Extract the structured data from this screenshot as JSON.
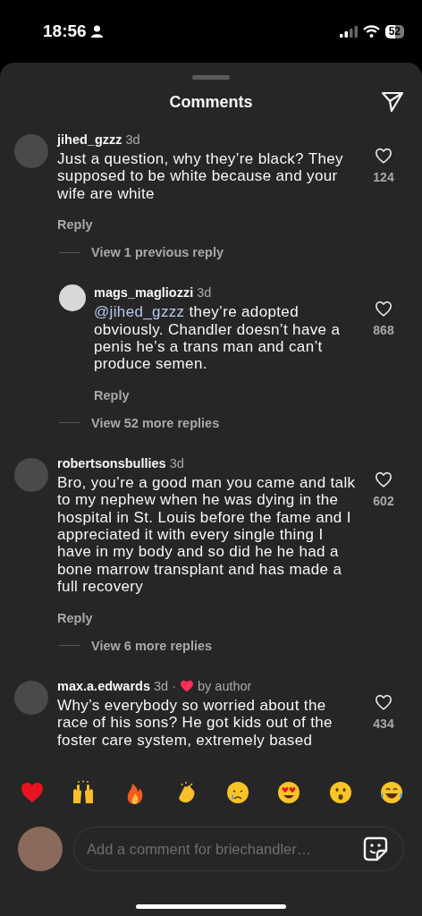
{
  "status_bar": {
    "time": "18:56",
    "battery": "52"
  },
  "header": {
    "title": "Comments"
  },
  "comments": [
    {
      "kind": "comment",
      "username": "jihed_gzzz",
      "time": "3d",
      "text": "Just a question, why they’re black? They supposed to be white because and your wife are white",
      "likes": "124",
      "reply_label": "Reply"
    },
    {
      "kind": "view_more",
      "label": "View 1 previous reply"
    },
    {
      "kind": "reply",
      "username": "mags_magliozzi",
      "time": "3d",
      "mention": "@jihed_gzzz",
      "text": "they’re adopted obviously. Chandler doesn’t have a penis he’s a trans man and can’t produce semen.",
      "likes": "868",
      "reply_label": "Reply"
    },
    {
      "kind": "view_more",
      "label": "View 52 more replies"
    },
    {
      "kind": "comment",
      "username": "robertsonsbullies",
      "time": "3d",
      "text": "Bro, you’re a good man you came and talk to my nephew when he was dying in the hospital in St. Louis before the fame and I appreciated it with every single thing I have in my body and so did he he had a bone marrow transplant and has made a full recovery",
      "likes": "602",
      "reply_label": "Reply"
    },
    {
      "kind": "view_more",
      "label": "View 6 more replies"
    },
    {
      "kind": "comment",
      "username": "max.a.edwards",
      "time": "3d",
      "separator": "·",
      "author_label": "by author",
      "text": "Why’s everybody so worried about the race of his sons? He got kids out of the foster care system, extremely based",
      "likes": "434"
    }
  ],
  "composer": {
    "placeholder": "Add a comment for briechandler…"
  }
}
